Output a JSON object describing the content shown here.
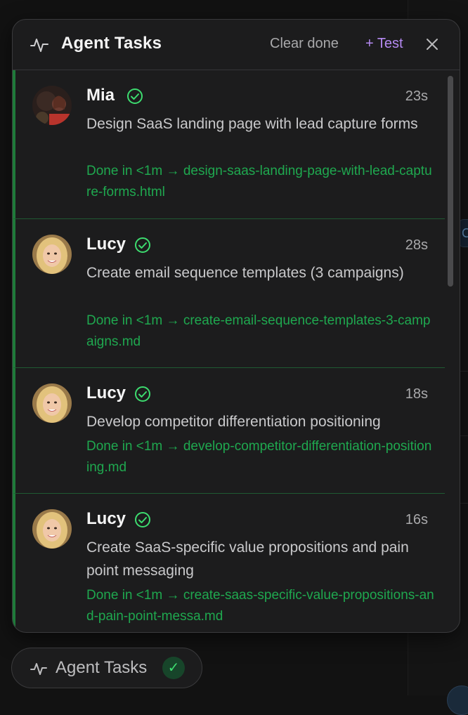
{
  "header": {
    "title": "Agent Tasks",
    "clear_label": "Clear done",
    "test_label": "+ Test"
  },
  "tasks": [
    {
      "name": "Mia",
      "time": "23s",
      "description": "Design SaaS landing page with lead capture forms",
      "done_text": "Done in <1m → design-saas-landing-page-with-lead-capture-forms.html",
      "avatar": "mia-avatar"
    },
    {
      "name": "Lucy",
      "time": "28s",
      "description": "Create email sequence templates (3 campaigns)",
      "done_text": "Done in <1m → create-email-sequence-templates-3-campaigns.md",
      "avatar": "lucy-avatar"
    },
    {
      "name": "Lucy",
      "time": "18s",
      "description": "Develop competitor differentiation positioning",
      "done_text": "Done in <1m → develop-competitor-differentiation-positioning.md",
      "avatar": "lucy-avatar"
    },
    {
      "name": "Lucy",
      "time": "16s",
      "description": "Create SaaS-specific value propositions and pain point messaging",
      "done_text": "Done in <1m → create-saas-specific-value-propositions-and-pain-point-messa.md",
      "avatar": "lucy-avatar"
    }
  ],
  "footer": {
    "label": "Agent Tasks",
    "badge": "✓"
  },
  "colors": {
    "accent_purple": "#b58af2",
    "done_green": "#1fa84f",
    "check_green": "#3ddc6f",
    "panel_bg": "#1c1c1d"
  }
}
